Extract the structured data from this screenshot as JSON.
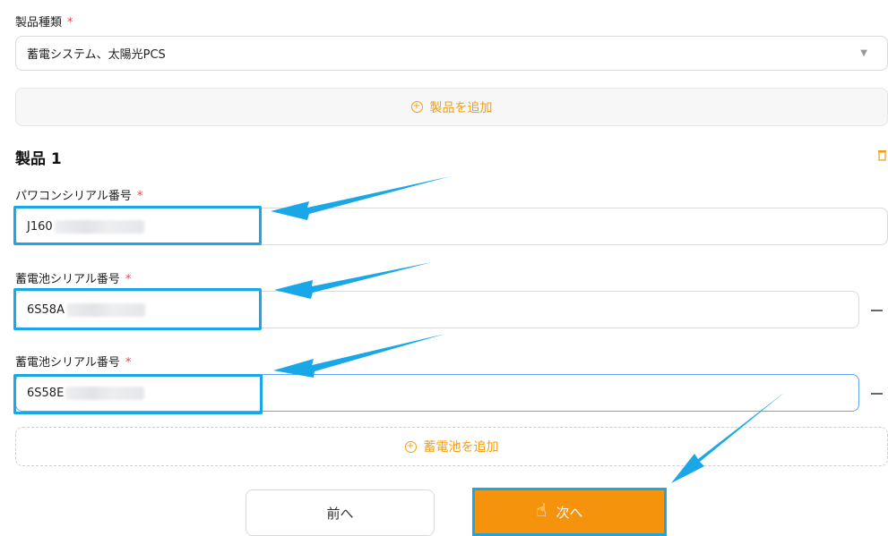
{
  "product_type": {
    "label": "製品種類",
    "required_mark": "*",
    "value": "蓄電システム、太陽光PCS"
  },
  "add_product_label": "製品を追加",
  "product": {
    "title": "製品 1",
    "pcs_serial": {
      "label": "パワコンシリアル番号",
      "required_mark": "*",
      "value": "J160"
    },
    "battery_serials": [
      {
        "label": "蓄電池シリアル番号",
        "required_mark": "*",
        "value": "6S58A"
      },
      {
        "label": "蓄電池シリアル番号",
        "required_mark": "*",
        "value": "6S58E"
      }
    ],
    "add_battery_label": "蓄電池を追加"
  },
  "nav": {
    "prev_label": "前へ",
    "next_label": "次へ"
  },
  "colors": {
    "accent": "#f5940c",
    "annotation": "#1aa7e8",
    "required": "#ef4444",
    "link": "#f59e0b"
  }
}
